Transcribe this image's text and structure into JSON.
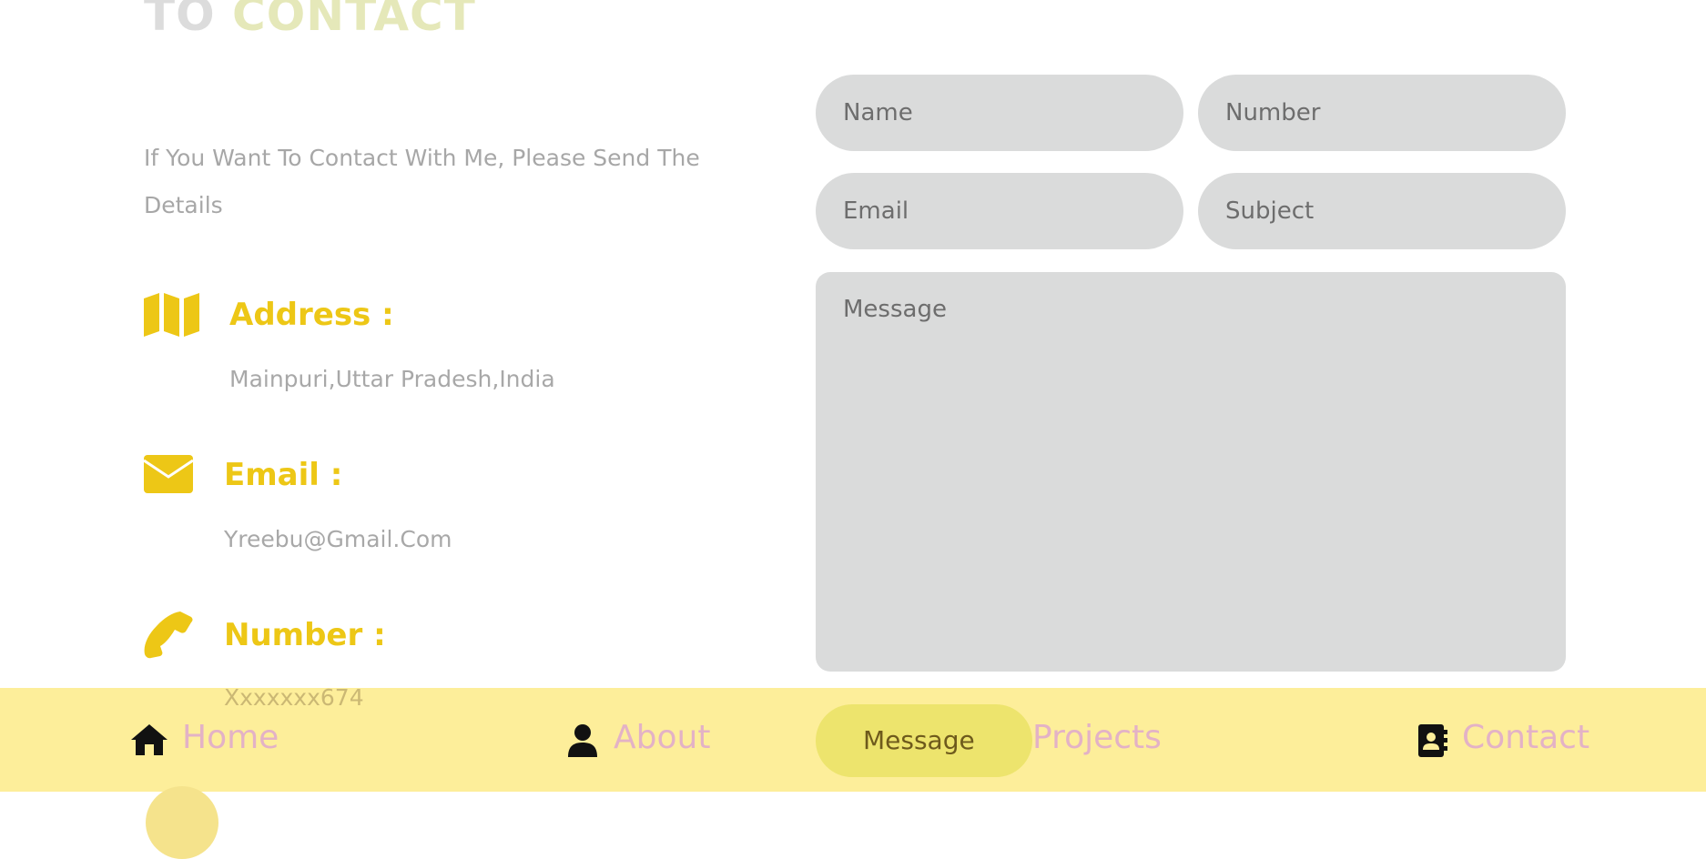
{
  "section": {
    "heading_word1": "TO",
    "heading_word2": "CONTACT",
    "intro": "If You Want To Contact With Me, Please Send The Details"
  },
  "contact_info": {
    "address": {
      "title": "Address :",
      "value": "Mainpuri,Uttar Pradesh,India",
      "icon": "map-icon"
    },
    "email": {
      "title": "Email :",
      "value": "Yreebu@Gmail.Com",
      "icon": "envelope-icon"
    },
    "number": {
      "title": "Number :",
      "value": "Xxxxxxx674",
      "icon": "phone-icon"
    }
  },
  "form": {
    "name_placeholder": "Name",
    "number_placeholder": "Number",
    "email_placeholder": "Email",
    "subject_placeholder": "Subject",
    "message_placeholder": "Message",
    "submit_label": "Message"
  },
  "nav": {
    "home": "Home",
    "about": "About",
    "projects": "Projects",
    "contact": "Contact"
  },
  "colors": {
    "accent": "#edc716",
    "bottombar": "#fdee9a",
    "field": "#dadbdb",
    "nav_text": "#e3b2c6"
  }
}
